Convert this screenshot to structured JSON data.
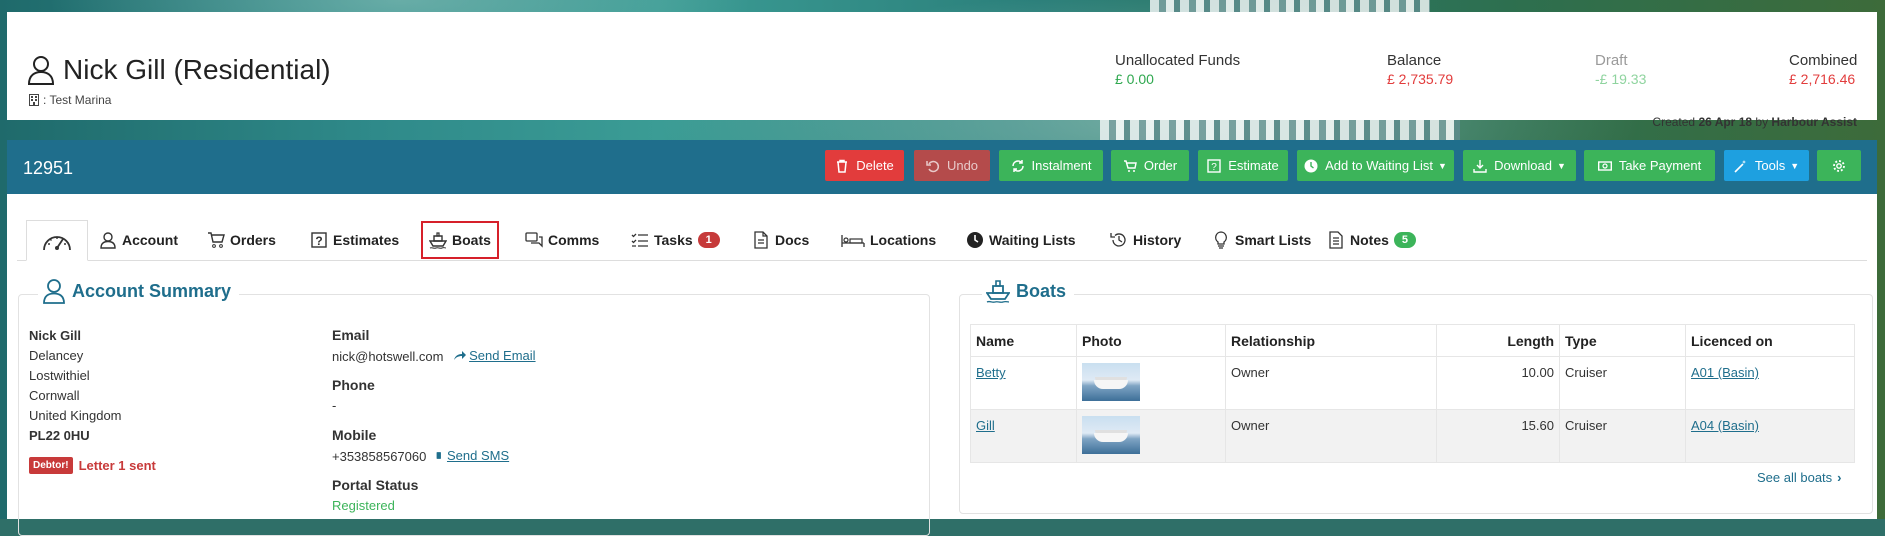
{
  "customer": {
    "name": "Nick Gill (Residential)",
    "marina": ": Test Marina"
  },
  "finance": {
    "unallocated": {
      "label": "Unallocated Funds",
      "value": "£ 0.00",
      "color": "#2fa84f"
    },
    "balance": {
      "label": "Balance",
      "value": "£ 2,735.79",
      "color": "#e23c3c"
    },
    "draft": {
      "label": "Draft",
      "value": "-£ 19.33",
      "color": "#8fd49f"
    },
    "combined": {
      "label": "Combined",
      "value": "£ 2,716.46",
      "color": "#e23c3c"
    }
  },
  "created": {
    "prefix": "Created",
    "date": "26 Apr 18",
    "by_word": "by",
    "by": "Harbour Assist"
  },
  "toolbar": {
    "account_number": "12951",
    "buttons": {
      "delete": "Delete",
      "undo": "Undo",
      "instalment": "Instalment",
      "order": "Order",
      "estimate": "Estimate",
      "waiting_list": "Add to Waiting List",
      "download": "Download",
      "take_payment": "Take Payment",
      "tools": "Tools"
    }
  },
  "tabs": {
    "account": "Account",
    "orders": "Orders",
    "estimates": "Estimates",
    "boats": "Boats",
    "comms": "Comms",
    "tasks": "Tasks",
    "tasks_count": "1",
    "docs": "Docs",
    "locations": "Locations",
    "waiting_lists": "Waiting Lists",
    "history": "History",
    "smart_lists": "Smart Lists",
    "notes": "Notes",
    "notes_count": "5"
  },
  "account_summary": {
    "title": "Account Summary",
    "address": {
      "name": "Nick Gill",
      "line1": "Delancey",
      "line2": "Lostwithiel",
      "line3": "Cornwall",
      "line4": "United Kingdom",
      "postcode": "PL22 0HU"
    },
    "debtor_tag": "Debtor!",
    "debtor_text": "Letter 1 sent",
    "email_label": "Email",
    "email": "nick@hotswell.com",
    "send_email": "Send Email",
    "phone_label": "Phone",
    "phone": "-",
    "mobile_label": "Mobile",
    "mobile": "+353858567060",
    "send_sms": "Send SMS",
    "portal_label": "Portal Status",
    "portal_status": "Registered"
  },
  "boats_panel": {
    "title": "Boats",
    "columns": {
      "name": "Name",
      "photo": "Photo",
      "relationship": "Relationship",
      "length": "Length",
      "type": "Type",
      "licenced": "Licenced on"
    },
    "rows": [
      {
        "name": "Betty",
        "relationship": "Owner",
        "length": "10.00",
        "type": "Cruiser",
        "licenced": "A01 (Basin)"
      },
      {
        "name": "Gill",
        "relationship": "Owner",
        "length": "15.60",
        "type": "Cruiser",
        "licenced": "A04 (Basin)"
      }
    ],
    "see_all": "See all boats"
  }
}
